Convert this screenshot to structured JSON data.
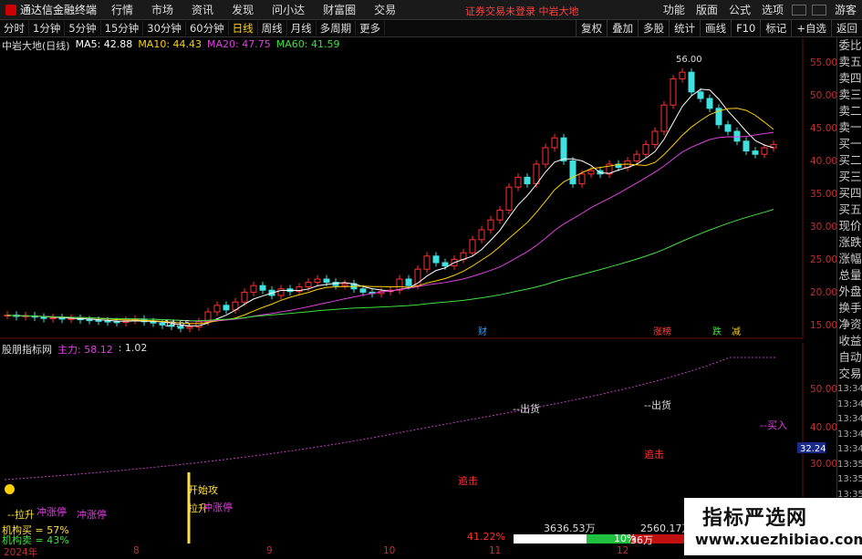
{
  "app": {
    "title": "通达信金融终端",
    "menu": [
      "行情",
      "市场",
      "资讯",
      "发现",
      "问小达",
      "财富圈",
      "交易"
    ],
    "notice": "证券交易未登录  中岩大地",
    "right_menu": [
      "功能",
      "版面",
      "公式",
      "选项"
    ],
    "user": "游客"
  },
  "periods": [
    "分时",
    "1分钟",
    "5分钟",
    "15分钟",
    "30分钟",
    "60分钟",
    "日线",
    "周线",
    "月线",
    "多周期",
    "更多"
  ],
  "active_period": "日线",
  "tools": [
    "复权",
    "叠加",
    "多股",
    "统计",
    "画线",
    "F10",
    "标记",
    "+自选",
    "返回"
  ],
  "stock_title": "中岩大地(日线)",
  "ma": [
    {
      "label": "MA5: 42.88",
      "color": "#ffffff"
    },
    {
      "label": "MA10: 44.43",
      "color": "#ffd000"
    },
    {
      "label": "MA20: 47.75",
      "color": "#e040e0"
    },
    {
      "label": "MA60: 41.59",
      "color": "#40e040"
    }
  ],
  "sidebar": [
    "委比",
    "卖五",
    "卖四",
    "卖三",
    "卖二",
    "卖一",
    "买一",
    "买二",
    "买三",
    "买四",
    "买五",
    "现价",
    "涨跌",
    "涨幅",
    "总量",
    "外盘",
    "换手",
    "净资",
    "收益",
    "自动",
    "交易",
    "13:34",
    "13:34",
    "13:34",
    "13:34",
    "13:34",
    "13:35",
    "13:35",
    "13:35",
    "13:35",
    "13:35",
    "13:35"
  ],
  "price_axis": [
    "55.00",
    "50.00",
    "45.00",
    "40.00",
    "35.00",
    "30.00",
    "25.00",
    "20.00",
    "15.00"
  ],
  "price_marks": {
    "high": "56.00",
    "low": "14.65"
  },
  "event_marks": {
    "cai": "财",
    "zhangbang": "涨榜",
    "die": "跌",
    "jian": "减"
  },
  "indicator": {
    "name": "股朋指标网",
    "main_label": "主力: 58.12",
    "ratio": ": 1.02",
    "axis": [
      "50.00",
      "40.00",
      "30.00"
    ],
    "current": "32.24"
  },
  "annotations": [
    "--出货",
    "--出货",
    "--买入",
    "追击",
    "追击",
    "开始攻",
    "拉升",
    "冲涨停",
    "--拉升",
    "冲涨停",
    "冲涨停",
    "机构买 = 57%",
    "机构卖 = 43%"
  ],
  "xaxis": [
    "2024年",
    "8",
    "9",
    "10",
    "11",
    "12"
  ],
  "footer": {
    "pct": "41.22%",
    "buy": "3636.53万",
    "sell": "2560.17万",
    "small": "36万",
    "pct2": "10%"
  },
  "watermark": {
    "line1": "指标严选网",
    "line2": "www.xuezhibiao.com"
  },
  "chart_data": {
    "type": "candlestick",
    "ylim": [
      13,
      58
    ],
    "high": 56.0,
    "low": 14.65,
    "closes": [
      17,
      16.8,
      16.9,
      16.7,
      16.5,
      16.6,
      16.4,
      16.5,
      16.3,
      16.2,
      16.1,
      16.0,
      15.9,
      16.2,
      16.4,
      16.0,
      15.8,
      15.5,
      15.3,
      15.0,
      15.2,
      16.0,
      17.5,
      18.5,
      17.8,
      19.0,
      20.5,
      21.5,
      20.8,
      20.0,
      21.0,
      20.6,
      21.3,
      22.0,
      22.5,
      22.0,
      21.5,
      21.8,
      21.0,
      20.5,
      20.3,
      20.6,
      20.8,
      22.5,
      21.5,
      24.0,
      26.0,
      25.0,
      24.5,
      25.5,
      26.5,
      28.5,
      30.0,
      31.5,
      33.0,
      36.5,
      38.0,
      37.0,
      40.0,
      42.5,
      44.0,
      40.5,
      37.0,
      38.5,
      39.0,
      38.5,
      40.0,
      39.5,
      40.5,
      41.5,
      43.0,
      45.0,
      49.0,
      53.0,
      54.0,
      51.0,
      50.0,
      48.5,
      46.0,
      45.0,
      43.5,
      42.0,
      41.5,
      42.5,
      43.0
    ]
  }
}
